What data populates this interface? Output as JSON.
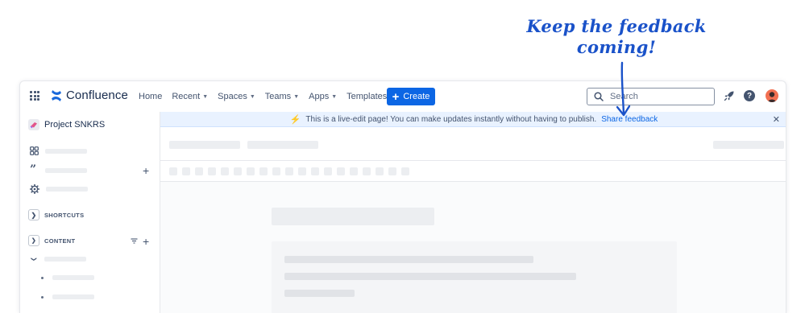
{
  "annotation": {
    "text_line1": "Keep the feedback",
    "text_line2": "coming!"
  },
  "app": {
    "product_name": "Confluence",
    "nav": {
      "home": "Home",
      "recent": "Recent",
      "spaces": "Spaces",
      "teams": "Teams",
      "apps": "Apps",
      "templates": "Templates"
    },
    "create_label": "Create",
    "search_placeholder": "Search",
    "help_glyph": "?",
    "icons": [
      "app-switcher-icon",
      "confluence-logo-icon",
      "chevron-down-icon",
      "plus-icon",
      "search-icon",
      "notification-rocket-icon",
      "help-icon",
      "avatar"
    ],
    "colors": {
      "primary": "#0c66e4",
      "banner_bg": "#e9f2ff",
      "annotation": "#1a52c9",
      "avatar": "#f27052"
    }
  },
  "sidebar": {
    "space_name": "Project SNKRS",
    "shortcuts_label": "SHORTCUTS",
    "content_label": "CONTENT"
  },
  "banner": {
    "message": "This is a live-edit page! You can make updates instantly without having to publish.",
    "link": "Share feedback"
  }
}
